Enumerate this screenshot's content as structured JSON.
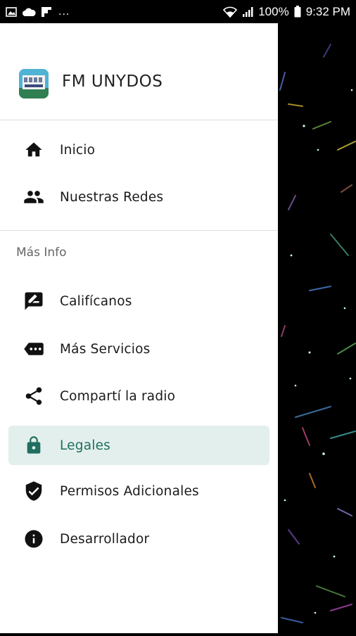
{
  "status_bar": {
    "battery": "100%",
    "time": "9:32 PM",
    "more": "..."
  },
  "drawer": {
    "app_name": "FM UNYDOS",
    "primary_items": [
      {
        "label": "Inicio",
        "icon": "home-icon"
      },
      {
        "label": "Nuestras Redes",
        "icon": "people-icon"
      }
    ],
    "section_title": "Más Info",
    "secondary_items": [
      {
        "label": "Califícanos",
        "icon": "rate-review-icon"
      },
      {
        "label": "Más Servicios",
        "icon": "label-tag-icon"
      },
      {
        "label": "Compartí la radio",
        "icon": "share-icon"
      },
      {
        "label": "Legales",
        "icon": "lock-icon",
        "active": true
      },
      {
        "label": "Permisos Adicionales",
        "icon": "verified-shield-icon"
      },
      {
        "label": "Desarrollador",
        "icon": "info-icon"
      }
    ]
  },
  "colors": {
    "active_bg": "#e3efec",
    "active_text": "#1f6f60",
    "icon": "#111111"
  }
}
